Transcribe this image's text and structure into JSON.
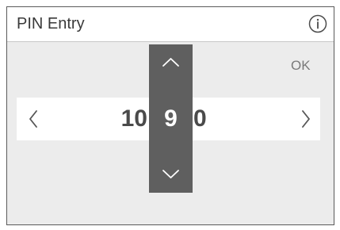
{
  "header": {
    "title": "PIN Entry",
    "info_icon": "info-icon"
  },
  "actions": {
    "ok_label": "OK"
  },
  "pin": {
    "previous_value": "10",
    "selected_value": "9",
    "next_value": "0",
    "left_icon": "chevron-left-icon",
    "right_icon": "chevron-right-icon",
    "up_icon": "chevron-up-icon",
    "down_icon": "chevron-down-icon"
  },
  "colors": {
    "background": "#ececec",
    "header": "#ffffff",
    "spinner": "#5f5f5f",
    "text": "#4a4a4a"
  }
}
